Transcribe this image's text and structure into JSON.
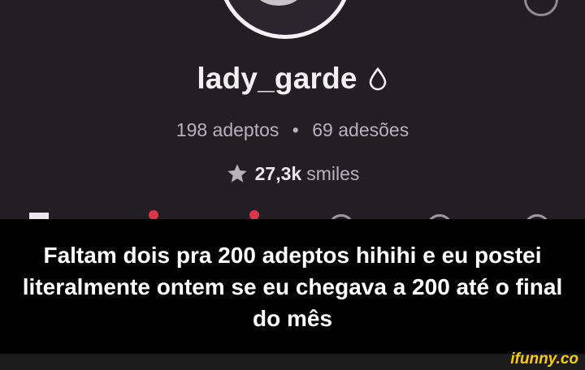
{
  "profile": {
    "username": "lady_garde",
    "followers_count": "198",
    "followers_label": "adeptos",
    "separator": "•",
    "subscriptions_count": "69",
    "subscriptions_label": "adesões",
    "smiles_count": "27,3k",
    "smiles_label": "smiles"
  },
  "caption": {
    "text": "Faltam dois pra 200 adeptos hihihi e eu postei literalmente ontem se eu chegava a 200 até o final do mês"
  },
  "watermark": {
    "text": "ifunny.co"
  },
  "colors": {
    "background": "#221f24",
    "caption_band": "#000000",
    "accent_red": "#e0344d",
    "watermark": "#ffcc00"
  },
  "icons": [
    "drop-icon",
    "star-icon"
  ]
}
